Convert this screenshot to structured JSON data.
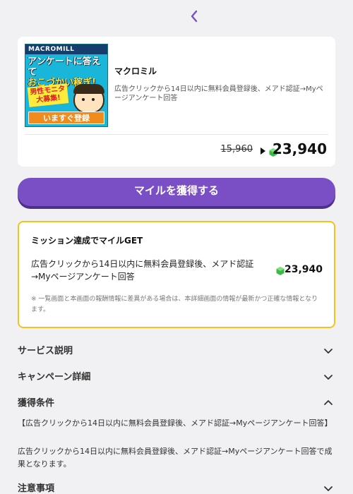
{
  "header": {
    "back_icon": "chevron-left-icon",
    "accent": "#7a4fc5"
  },
  "offer": {
    "banner": {
      "brand": "MACROMILL",
      "headline_line1": "アンケートに答えて",
      "headline_line2": "おこづかい稼ぎ!",
      "tag": "男性モニタ大募集!",
      "cta": "いますぐ登録"
    },
    "title": "マクロミル",
    "description": "広告クリックから14日以内に無料会員登録後、メアド認証→Myページアンケート回答",
    "old_points": "15,960",
    "new_points": "23,940"
  },
  "get_button": {
    "label": "マイルを獲得する"
  },
  "mission": {
    "title": "ミッション達成でマイルGET",
    "description": "広告クリックから14日以内に無料会員登録後、メアド認証→Myページアンケート回答",
    "points": "23,940",
    "note": "※ 一覧画面と本画面の報酬情報に差異がある場合は、本詳細画面の情報が最新かつ正確な情報となります。",
    "border_color": "#f3c31a"
  },
  "sections": {
    "service": {
      "label": "サービス説明",
      "expanded": false
    },
    "campaign": {
      "label": "キャンペーン詳細",
      "expanded": false
    },
    "conditions": {
      "label": "獲得条件",
      "expanded": true,
      "text1": "【広告クリックから14日以内に無料会員登録後、メアド認証→Myページアンケート回答】",
      "text2": "広告クリックから14日以内に無料会員登録後、メアド認証→Myページアンケート回答で成果となります。"
    },
    "notes": {
      "label": "注意事項",
      "expanded": false
    }
  },
  "colors": {
    "gem": "#3db84a",
    "button_bg": "#7a4fc5",
    "button_shadow": "#4f2f8c"
  }
}
